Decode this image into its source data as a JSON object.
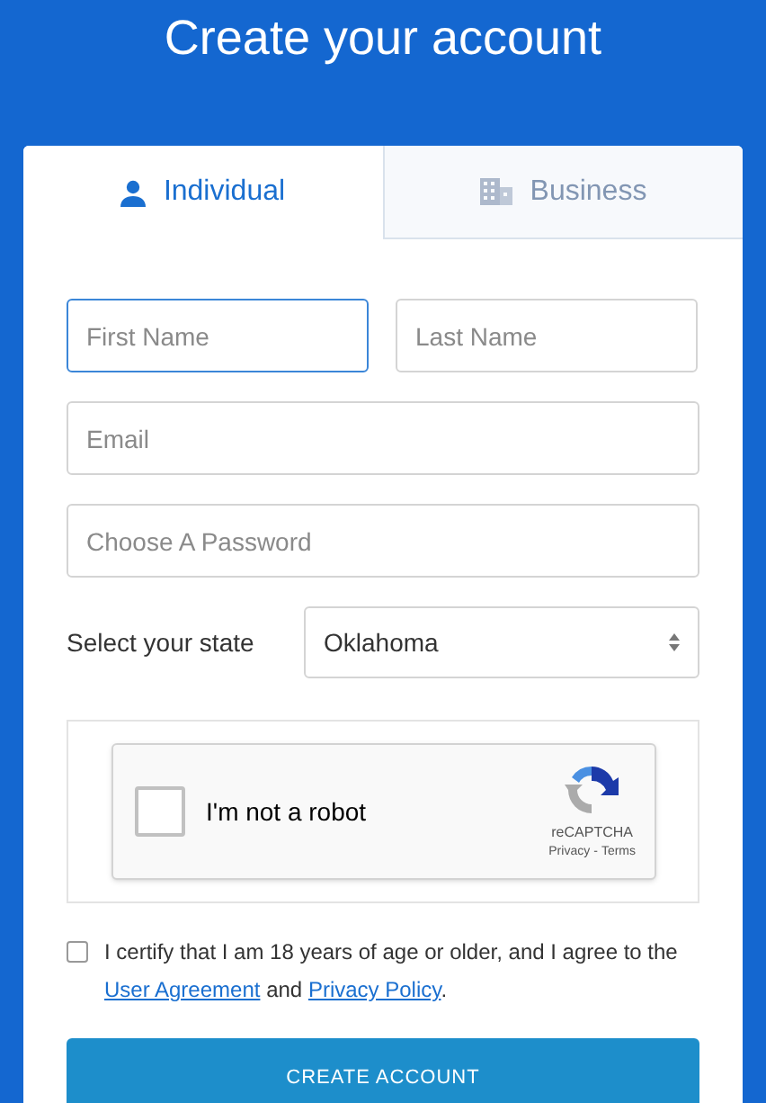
{
  "title": "Create your account",
  "tabs": [
    {
      "label": "Individual",
      "kind": "person",
      "selected": true
    },
    {
      "label": "Business",
      "kind": "building",
      "selected": false
    }
  ],
  "name_fields": [
    {
      "placeholder": "First Name",
      "focused": true
    },
    {
      "placeholder": "Last Name",
      "focused": false
    }
  ],
  "fields": [
    {
      "placeholder": "Email",
      "focused": false
    },
    {
      "placeholder": "Choose A Password",
      "focused": false
    }
  ],
  "state": {
    "label": "Select your state",
    "value": "Oklahoma"
  },
  "captcha": {
    "label": "I'm not a robot",
    "checked": false,
    "brand": "reCAPTCHA",
    "privacy": "Privacy",
    "separator": "-",
    "terms": "Terms"
  },
  "agreement": {
    "checked": false,
    "text": "I certify that I am 18 years of age or older, and I agree to the",
    "link_1": "User Agreement",
    "middle": "and",
    "link_2": "Privacy Policy",
    "end": "."
  },
  "submit": "CREATE ACCOUNT"
}
